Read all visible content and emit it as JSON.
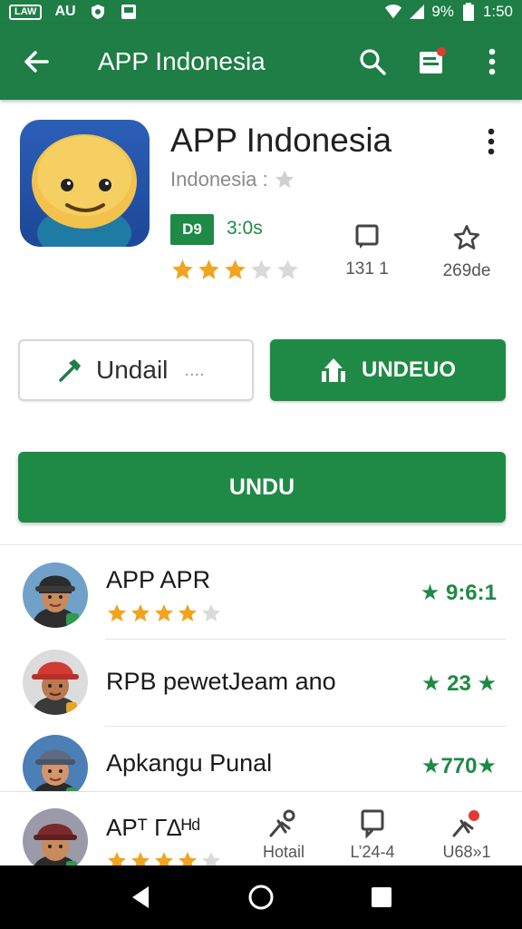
{
  "status_bar": {
    "left_box": "LAW",
    "left_text": "AU",
    "battery": "9%",
    "time": "1:50"
  },
  "app_bar": {
    "title": "APP Indonesia",
    "icons": [
      "back-arrow-icon",
      "search-icon",
      "bookmark-badge-icon",
      "more-vert-icon"
    ]
  },
  "app": {
    "name": "APP Indonesia",
    "developer": "Indonesia :",
    "rated_badge": "D9",
    "rating_text": "3:0s",
    "star_count": 5,
    "stars_filled": 3,
    "stat_reviews": "131 1",
    "stat_rating": "269de"
  },
  "buttons": {
    "outline_label": "Undail",
    "outline_suffix": "....",
    "fill_label": "UNDEUO",
    "wide_label": "UNDU"
  },
  "list": [
    {
      "title": "APP APR",
      "rating": "★ 9:6:1",
      "stars_filled": 4
    },
    {
      "title": "RPB pewetJeam ano",
      "rating": "★ 23 ★"
    },
    {
      "title": "Apkangu Punal",
      "rating": "★770★"
    },
    {
      "title": "APᵀ Г∆ᴴᵈ",
      "rating": "",
      "stars_filled": 4
    }
  ],
  "bottom_nav": [
    {
      "label": "Hotail",
      "icon": "share-pin-icon"
    },
    {
      "label": "L’24-4",
      "icon": "bookmark-icon"
    },
    {
      "label": "U68»1",
      "icon": "share-pin-badge-icon"
    }
  ],
  "colors": {
    "primary": "#1e7e45",
    "accent": "#1e8a45",
    "star": "#f0a41f"
  }
}
